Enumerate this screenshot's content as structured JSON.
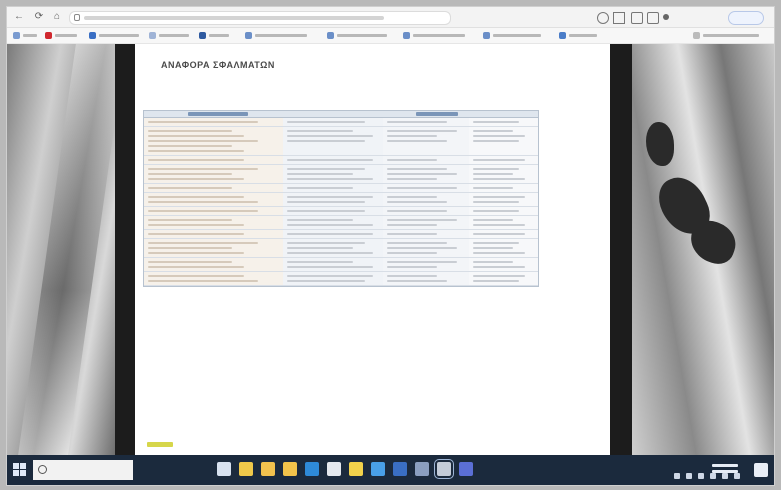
{
  "browser": {
    "nav": [
      {
        "name": "back-icon",
        "glyph": "←"
      },
      {
        "name": "refresh-icon",
        "glyph": "⟳"
      },
      {
        "name": "home-icon",
        "glyph": "⌂"
      }
    ],
    "bookmarks_count": 10
  },
  "page": {
    "heading": "ΑΝΑΦΟΡΑ ΣΦΑΛΜΑΤΩΝ",
    "subtitle": "",
    "phone_label": "",
    "phone_number": "",
    "table": {
      "columns": [
        "",
        "",
        "",
        ""
      ],
      "rows": [
        {
          "label": "",
          "lines": [
            1,
            1,
            1,
            1
          ]
        },
        {
          "label": "",
          "lines": [
            5,
            3,
            3,
            3
          ]
        },
        {
          "label": "",
          "lines": [
            1,
            1,
            1,
            1
          ]
        },
        {
          "label": "",
          "lines": [
            3,
            3,
            3,
            3
          ]
        },
        {
          "label": "",
          "lines": [
            1,
            1,
            1,
            1
          ]
        },
        {
          "label": "",
          "lines": [
            2,
            2,
            2,
            2
          ]
        },
        {
          "label": "",
          "lines": [
            1,
            1,
            1,
            1
          ]
        },
        {
          "label": "",
          "lines": [
            2,
            2,
            2,
            2
          ]
        },
        {
          "label": "",
          "lines": [
            1,
            1,
            1,
            1
          ]
        },
        {
          "label": "",
          "lines": [
            3,
            3,
            3,
            3
          ]
        },
        {
          "label": "",
          "lines": [
            2,
            2,
            2,
            2
          ]
        },
        {
          "label": "",
          "lines": [
            2,
            2,
            2,
            2
          ]
        }
      ]
    }
  },
  "taskbar": {
    "search_placeholder": "",
    "apps": [
      {
        "name": "task-view-icon",
        "color": "#d8e2f0"
      },
      {
        "name": "store-icon",
        "color": "#f0c94a"
      },
      {
        "name": "mail-icon",
        "color": "#f2c24e"
      },
      {
        "name": "explorer-icon",
        "color": "#f3c44b"
      },
      {
        "name": "edge-icon",
        "color": "#2e8ad8"
      },
      {
        "name": "browser-icon",
        "color": "#e5e9ef"
      },
      {
        "name": "security-icon",
        "color": "#f2d24b"
      },
      {
        "name": "app-icon",
        "color": "#49a0e8"
      },
      {
        "name": "word-icon",
        "color": "#3a6fc4"
      },
      {
        "name": "app2-icon",
        "color": "#8b9fc0"
      },
      {
        "name": "app3-icon",
        "color": "#c4ccd8"
      },
      {
        "name": "teams-icon",
        "color": "#5b6fd6"
      }
    ]
  },
  "colors": {
    "accent_red": "#d0282e",
    "header_blue": "#7a95b8",
    "taskbar": "#1b2a3d"
  }
}
